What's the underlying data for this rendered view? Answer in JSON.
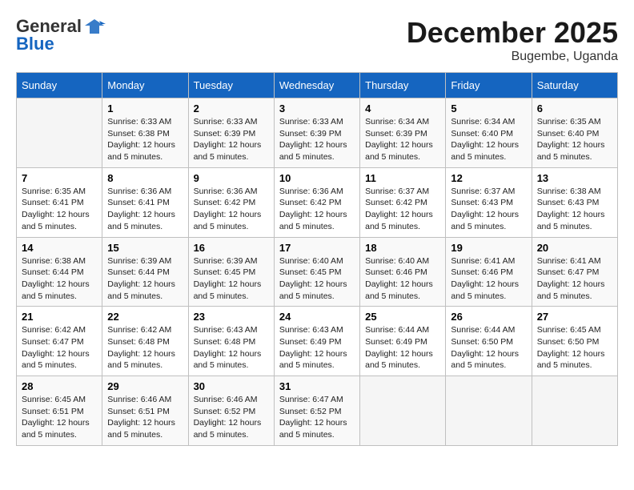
{
  "logo": {
    "general": "General",
    "blue": "Blue"
  },
  "title": "December 2025",
  "subtitle": "Bugembe, Uganda",
  "days_of_week": [
    "Sunday",
    "Monday",
    "Tuesday",
    "Wednesday",
    "Thursday",
    "Friday",
    "Saturday"
  ],
  "weeks": [
    [
      {
        "day": "",
        "sunrise": "",
        "sunset": "",
        "daylight": ""
      },
      {
        "day": "1",
        "sunrise": "Sunrise: 6:33 AM",
        "sunset": "Sunset: 6:38 PM",
        "daylight": "Daylight: 12 hours and 5 minutes."
      },
      {
        "day": "2",
        "sunrise": "Sunrise: 6:33 AM",
        "sunset": "Sunset: 6:39 PM",
        "daylight": "Daylight: 12 hours and 5 minutes."
      },
      {
        "day": "3",
        "sunrise": "Sunrise: 6:33 AM",
        "sunset": "Sunset: 6:39 PM",
        "daylight": "Daylight: 12 hours and 5 minutes."
      },
      {
        "day": "4",
        "sunrise": "Sunrise: 6:34 AM",
        "sunset": "Sunset: 6:39 PM",
        "daylight": "Daylight: 12 hours and 5 minutes."
      },
      {
        "day": "5",
        "sunrise": "Sunrise: 6:34 AM",
        "sunset": "Sunset: 6:40 PM",
        "daylight": "Daylight: 12 hours and 5 minutes."
      },
      {
        "day": "6",
        "sunrise": "Sunrise: 6:35 AM",
        "sunset": "Sunset: 6:40 PM",
        "daylight": "Daylight: 12 hours and 5 minutes."
      }
    ],
    [
      {
        "day": "7",
        "sunrise": "Sunrise: 6:35 AM",
        "sunset": "Sunset: 6:41 PM",
        "daylight": "Daylight: 12 hours and 5 minutes."
      },
      {
        "day": "8",
        "sunrise": "Sunrise: 6:36 AM",
        "sunset": "Sunset: 6:41 PM",
        "daylight": "Daylight: 12 hours and 5 minutes."
      },
      {
        "day": "9",
        "sunrise": "Sunrise: 6:36 AM",
        "sunset": "Sunset: 6:42 PM",
        "daylight": "Daylight: 12 hours and 5 minutes."
      },
      {
        "day": "10",
        "sunrise": "Sunrise: 6:36 AM",
        "sunset": "Sunset: 6:42 PM",
        "daylight": "Daylight: 12 hours and 5 minutes."
      },
      {
        "day": "11",
        "sunrise": "Sunrise: 6:37 AM",
        "sunset": "Sunset: 6:42 PM",
        "daylight": "Daylight: 12 hours and 5 minutes."
      },
      {
        "day": "12",
        "sunrise": "Sunrise: 6:37 AM",
        "sunset": "Sunset: 6:43 PM",
        "daylight": "Daylight: 12 hours and 5 minutes."
      },
      {
        "day": "13",
        "sunrise": "Sunrise: 6:38 AM",
        "sunset": "Sunset: 6:43 PM",
        "daylight": "Daylight: 12 hours and 5 minutes."
      }
    ],
    [
      {
        "day": "14",
        "sunrise": "Sunrise: 6:38 AM",
        "sunset": "Sunset: 6:44 PM",
        "daylight": "Daylight: 12 hours and 5 minutes."
      },
      {
        "day": "15",
        "sunrise": "Sunrise: 6:39 AM",
        "sunset": "Sunset: 6:44 PM",
        "daylight": "Daylight: 12 hours and 5 minutes."
      },
      {
        "day": "16",
        "sunrise": "Sunrise: 6:39 AM",
        "sunset": "Sunset: 6:45 PM",
        "daylight": "Daylight: 12 hours and 5 minutes."
      },
      {
        "day": "17",
        "sunrise": "Sunrise: 6:40 AM",
        "sunset": "Sunset: 6:45 PM",
        "daylight": "Daylight: 12 hours and 5 minutes."
      },
      {
        "day": "18",
        "sunrise": "Sunrise: 6:40 AM",
        "sunset": "Sunset: 6:46 PM",
        "daylight": "Daylight: 12 hours and 5 minutes."
      },
      {
        "day": "19",
        "sunrise": "Sunrise: 6:41 AM",
        "sunset": "Sunset: 6:46 PM",
        "daylight": "Daylight: 12 hours and 5 minutes."
      },
      {
        "day": "20",
        "sunrise": "Sunrise: 6:41 AM",
        "sunset": "Sunset: 6:47 PM",
        "daylight": "Daylight: 12 hours and 5 minutes."
      }
    ],
    [
      {
        "day": "21",
        "sunrise": "Sunrise: 6:42 AM",
        "sunset": "Sunset: 6:47 PM",
        "daylight": "Daylight: 12 hours and 5 minutes."
      },
      {
        "day": "22",
        "sunrise": "Sunrise: 6:42 AM",
        "sunset": "Sunset: 6:48 PM",
        "daylight": "Daylight: 12 hours and 5 minutes."
      },
      {
        "day": "23",
        "sunrise": "Sunrise: 6:43 AM",
        "sunset": "Sunset: 6:48 PM",
        "daylight": "Daylight: 12 hours and 5 minutes."
      },
      {
        "day": "24",
        "sunrise": "Sunrise: 6:43 AM",
        "sunset": "Sunset: 6:49 PM",
        "daylight": "Daylight: 12 hours and 5 minutes."
      },
      {
        "day": "25",
        "sunrise": "Sunrise: 6:44 AM",
        "sunset": "Sunset: 6:49 PM",
        "daylight": "Daylight: 12 hours and 5 minutes."
      },
      {
        "day": "26",
        "sunrise": "Sunrise: 6:44 AM",
        "sunset": "Sunset: 6:50 PM",
        "daylight": "Daylight: 12 hours and 5 minutes."
      },
      {
        "day": "27",
        "sunrise": "Sunrise: 6:45 AM",
        "sunset": "Sunset: 6:50 PM",
        "daylight": "Daylight: 12 hours and 5 minutes."
      }
    ],
    [
      {
        "day": "28",
        "sunrise": "Sunrise: 6:45 AM",
        "sunset": "Sunset: 6:51 PM",
        "daylight": "Daylight: 12 hours and 5 minutes."
      },
      {
        "day": "29",
        "sunrise": "Sunrise: 6:46 AM",
        "sunset": "Sunset: 6:51 PM",
        "daylight": "Daylight: 12 hours and 5 minutes."
      },
      {
        "day": "30",
        "sunrise": "Sunrise: 6:46 AM",
        "sunset": "Sunset: 6:52 PM",
        "daylight": "Daylight: 12 hours and 5 minutes."
      },
      {
        "day": "31",
        "sunrise": "Sunrise: 6:47 AM",
        "sunset": "Sunset: 6:52 PM",
        "daylight": "Daylight: 12 hours and 5 minutes."
      },
      {
        "day": "",
        "sunrise": "",
        "sunset": "",
        "daylight": ""
      },
      {
        "day": "",
        "sunrise": "",
        "sunset": "",
        "daylight": ""
      },
      {
        "day": "",
        "sunrise": "",
        "sunset": "",
        "daylight": ""
      }
    ]
  ]
}
